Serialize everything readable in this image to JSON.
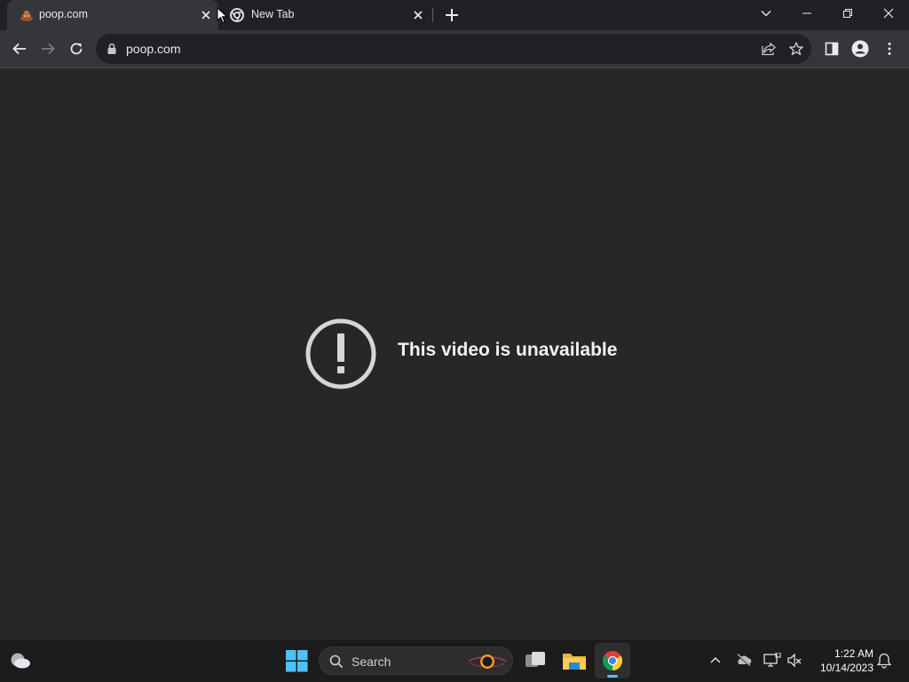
{
  "tabs": [
    {
      "title": "poop.com",
      "active": true,
      "favicon": "poop-emoji-icon"
    },
    {
      "title": "New Tab",
      "active": false,
      "favicon": "chrome-icon"
    }
  ],
  "address_bar": {
    "url": "poop.com"
  },
  "content": {
    "message": "This video is unavailable",
    "icon": "alert-exclamation-icon"
  },
  "taskbar": {
    "search_label": "Search",
    "time": "1:22 AM",
    "date": "10/14/2023"
  },
  "colors": {
    "background": "#272727",
    "tabstrip": "#202124",
    "toolbar": "#35363a",
    "taskbar": "#1c1c1c",
    "accent": "#4cc2ff"
  }
}
